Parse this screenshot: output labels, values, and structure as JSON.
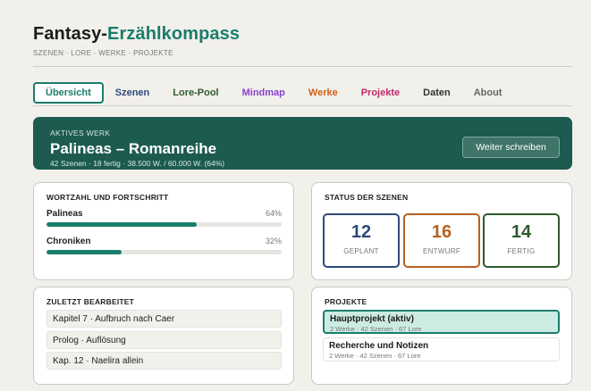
{
  "header": {
    "title_part1": "Fantasy-",
    "title_part2": "Erzählkompass",
    "subtitle": "SZENEN · LORE · WERKE · PROJEKTE"
  },
  "tabs": [
    {
      "label": "Übersicht",
      "color": "#1a7d6c",
      "active": true
    },
    {
      "label": "Szenen",
      "color": "#2f4a7a"
    },
    {
      "label": "Lore-Pool",
      "color": "#2e5a2e"
    },
    {
      "label": "Mindmap",
      "color": "#8a3fd0"
    },
    {
      "label": "Werke",
      "color": "#d0601a"
    },
    {
      "label": "Projekte",
      "color": "#c02a6a"
    },
    {
      "label": "Daten",
      "color": "#333333"
    },
    {
      "label": "About",
      "color": "#666666"
    }
  ],
  "banner": {
    "label": "AKTIVES WERK",
    "title": "Palineas – Romanreihe",
    "meta": "42 Szenen · 18 fertig · 38.500 W. / 60.000 W. (64%)",
    "button": "Weiter schreiben"
  },
  "progress": {
    "title": "WORTZAHL UND FORTSCHRITT",
    "items": [
      {
        "name": "Palineas",
        "pct_label": "64%",
        "value": 64
      },
      {
        "name": "Chroniken",
        "pct_label": "32%",
        "value": 32
      }
    ]
  },
  "status": {
    "title": "STATUS DER SZENEN",
    "items": [
      {
        "count": "12",
        "label": "GEPLANT",
        "color": "#2f4a7a"
      },
      {
        "count": "16",
        "label": "ENTWURF",
        "color": "#b8601f"
      },
      {
        "count": "14",
        "label": "FERTIG",
        "color": "#2e5a2e"
      }
    ]
  },
  "recent": {
    "title": "ZULETZT BEARBEITET",
    "items": [
      "Kapitel 7 · Aufbruch nach Caer",
      "Prolog · Auflösung",
      "Kap. 12 · Naelira allein"
    ]
  },
  "projects": {
    "title": "PROJEKTE",
    "items": [
      {
        "name": "Hauptprojekt (aktiv)",
        "meta": "2 Werke · 42 Szenen · 67 Lore"
      },
      {
        "name": "Recherche und Notizen",
        "meta": "2 Werke · 42 Szenen · 67 Lore"
      }
    ]
  }
}
